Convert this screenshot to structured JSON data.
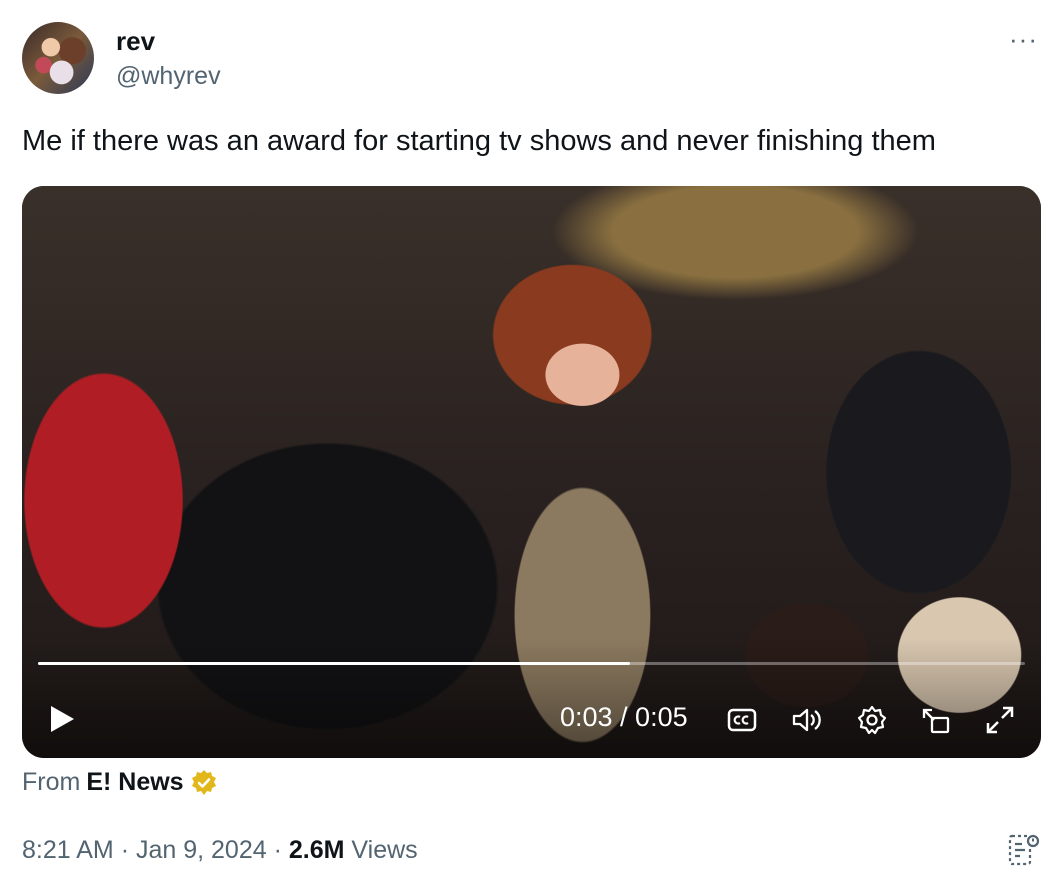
{
  "user": {
    "name": "rev",
    "handle": "@whyrev"
  },
  "menu_glyph": "···",
  "tweet": {
    "text": "Me if there was an award for starting tv shows and never finishing them"
  },
  "video": {
    "current_time": "0:03",
    "duration": "0:05",
    "time_display": "0:03 / 0:05",
    "progress": 0.6
  },
  "source": {
    "prefix": "From",
    "name": "E! News"
  },
  "meta": {
    "time": "8:21 AM",
    "sep": "·",
    "date": "Jan 9, 2024",
    "views_count": "2.6M",
    "views_label": "Views"
  },
  "colors": {
    "text": "#0f1419",
    "secondary": "#536471",
    "verified_gold": "#e2b719"
  }
}
